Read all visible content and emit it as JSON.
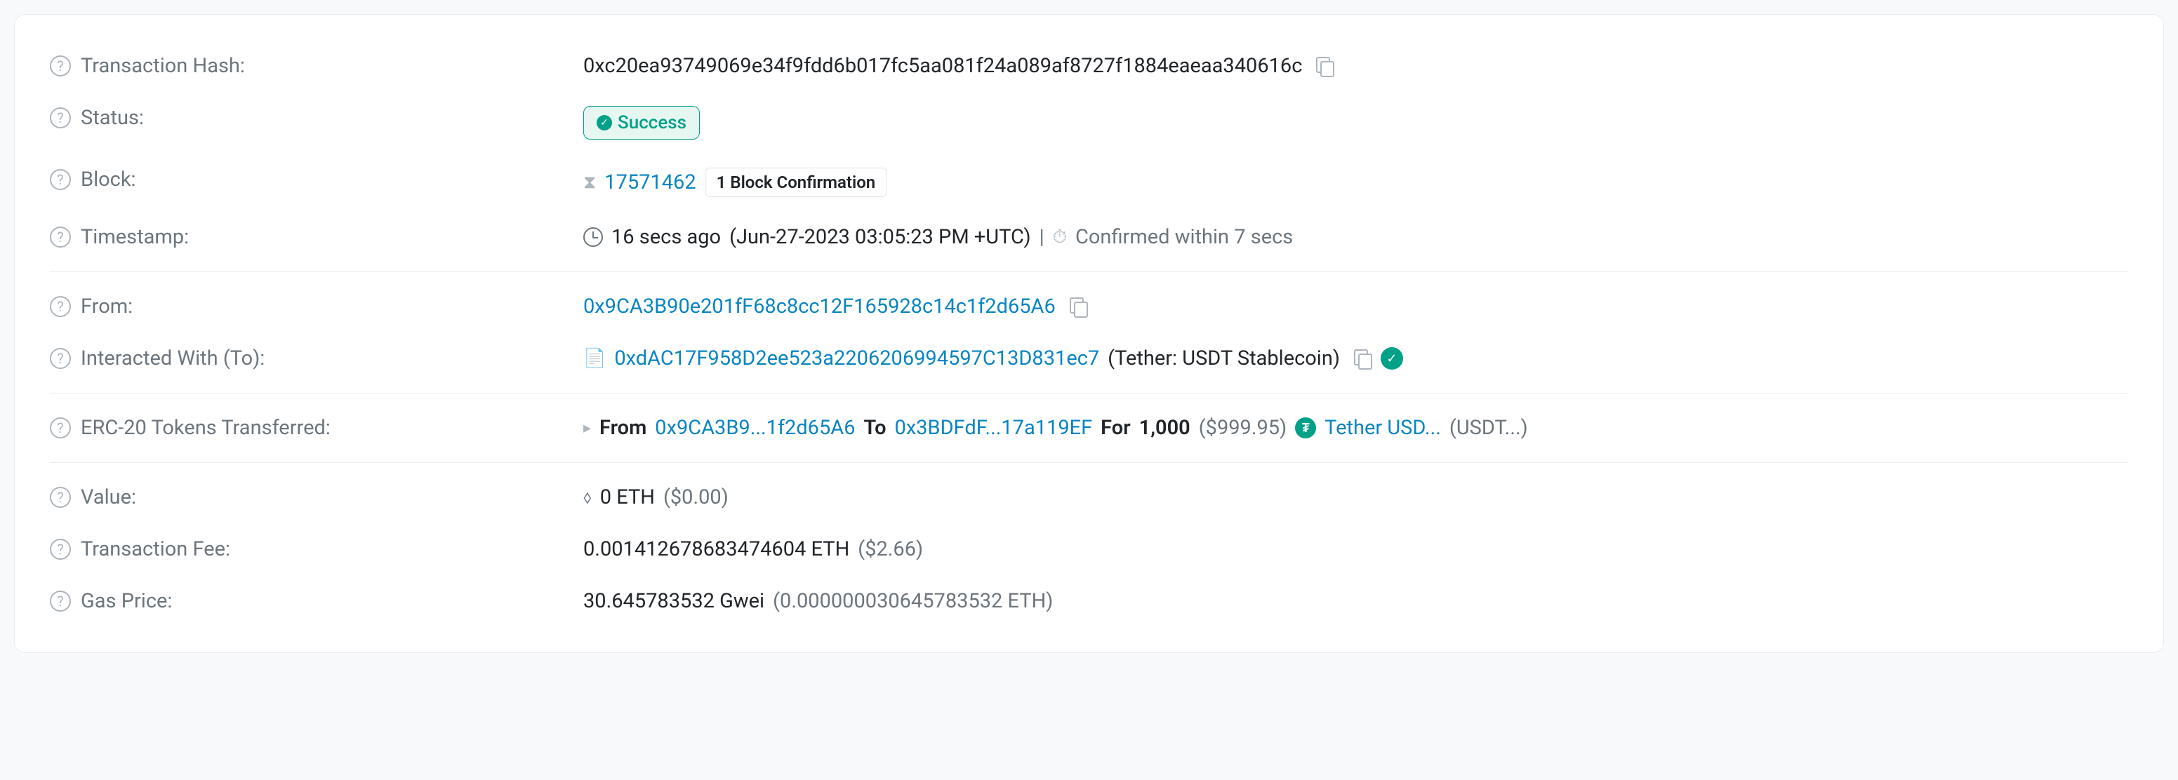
{
  "labels": {
    "txhash": "Transaction Hash:",
    "status": "Status:",
    "block": "Block:",
    "timestamp": "Timestamp:",
    "from": "From:",
    "to": "Interacted With (To):",
    "erc20": "ERC-20 Tokens Transferred:",
    "value": "Value:",
    "txfee": "Transaction Fee:",
    "gasprice": "Gas Price:"
  },
  "txhash": "0xc20ea93749069e34f9fdd6b017fc5aa081f24a089af8727f1884eaeaa340616c",
  "status": "Success",
  "block": {
    "number": "17571462",
    "confirmations": "1 Block Confirmation"
  },
  "timestamp": {
    "ago": "16 secs ago",
    "full": "(Jun-27-2023 03:05:23 PM +UTC)",
    "confirmed": "Confirmed within 7 secs"
  },
  "from": "0x9CA3B90e201fF68c8cc12F165928c14c1f2d65A6",
  "to": {
    "address": "0xdAC17F958D2ee523a2206206994597C13D831ec7",
    "name": "(Tether: USDT Stablecoin)"
  },
  "erc20": {
    "from_label": "From",
    "from_addr": "0x9CA3B9...1f2d65A6",
    "to_label": "To",
    "to_addr": "0x3BDFdF...17a119EF",
    "for_label": "For",
    "amount": "1,000",
    "usd": "($999.95)",
    "token_name": "Tether USD...",
    "token_symbol": "(USDT...)"
  },
  "value": {
    "eth": "0 ETH",
    "usd": "($0.00)"
  },
  "txfee": {
    "eth": "0.001412678683474604 ETH",
    "usd": "($2.66)"
  },
  "gasprice": {
    "gwei": "30.645783532 Gwei",
    "eth": "(0.000000030645783532 ETH)"
  }
}
